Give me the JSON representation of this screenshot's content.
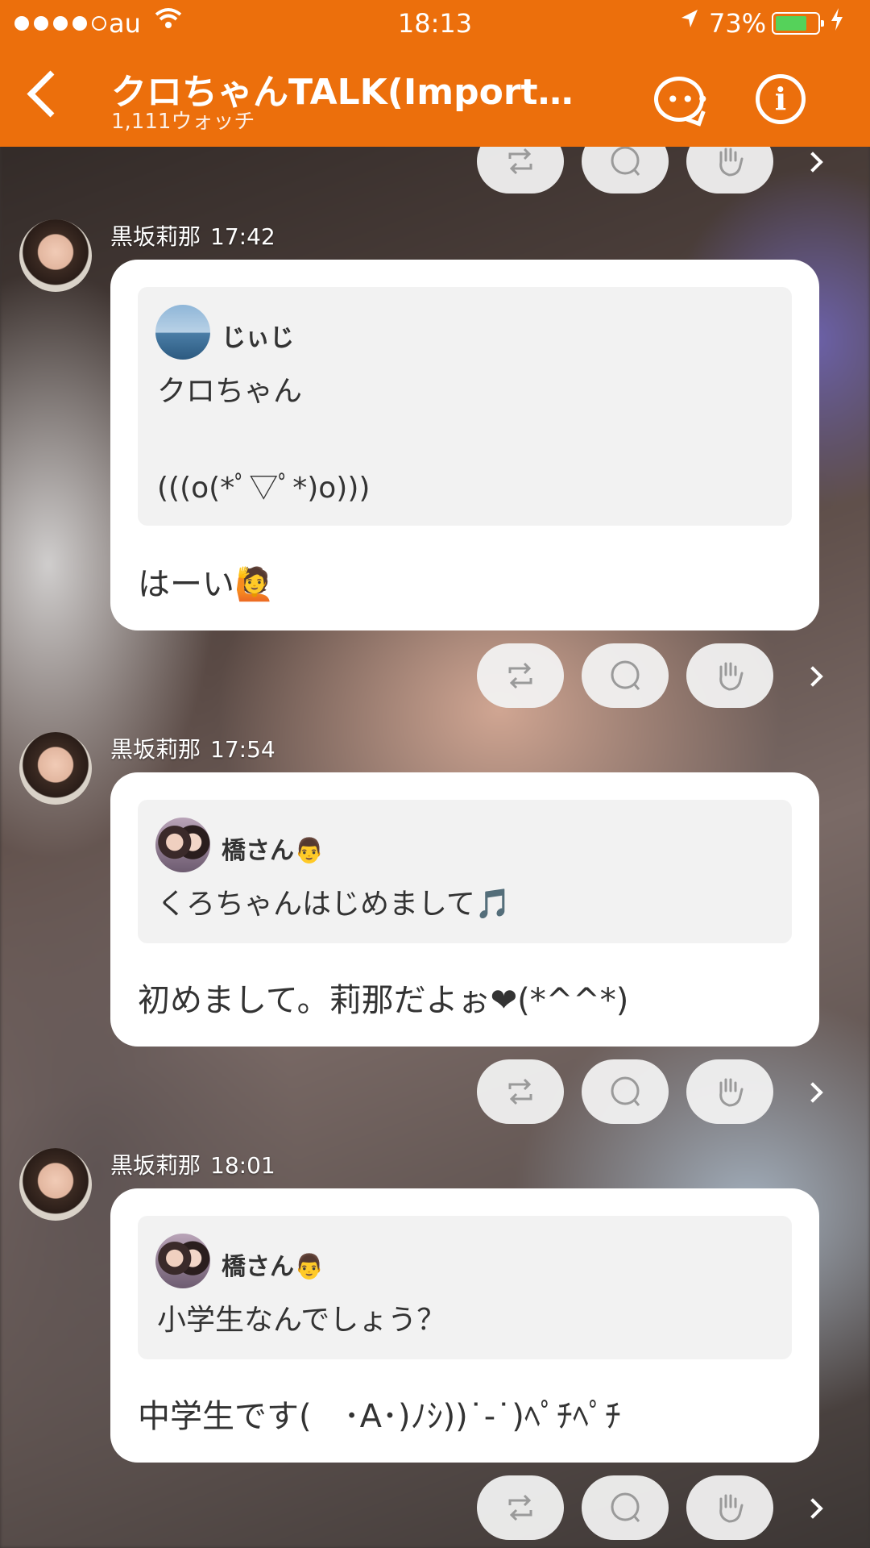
{
  "status_bar": {
    "carrier": "au",
    "time": "18:13",
    "battery": "73%",
    "battery_level": 0.73
  },
  "header": {
    "title": "クロちゃんTALK(Importan…",
    "watchers": "1,111ウォッチ"
  },
  "posts": [
    {
      "author": "黒坂莉那",
      "time": "17:42",
      "quote_author": "じぃじ",
      "quote_text": "クロちゃん\n\n(((o(*ﾟ▽ﾟ*)o)))",
      "reply": "はーい🙋"
    },
    {
      "author": "黒坂莉那",
      "time": "17:54",
      "quote_author": "橋さん👨",
      "quote_text": "くろちゃんはじめまして🎵",
      "reply": "初めまして。莉那だよぉ❤(*^^*)"
    },
    {
      "author": "黒坂莉那",
      "time": "18:01",
      "quote_author": "橋さん👨",
      "quote_text": "小学生なんでしょう？",
      "reply": "中学生です(　･A･)ﾉｼ))˙-˙)ﾍﾟﾁﾍﾟﾁ"
    }
  ],
  "icons": {
    "retweet": "retweet-icon",
    "comment": "comment-icon",
    "clap": "clap-icon",
    "more": "chevron-right-icon"
  },
  "colors": {
    "header": "#ec6f0c",
    "battery": "#55d25a"
  }
}
